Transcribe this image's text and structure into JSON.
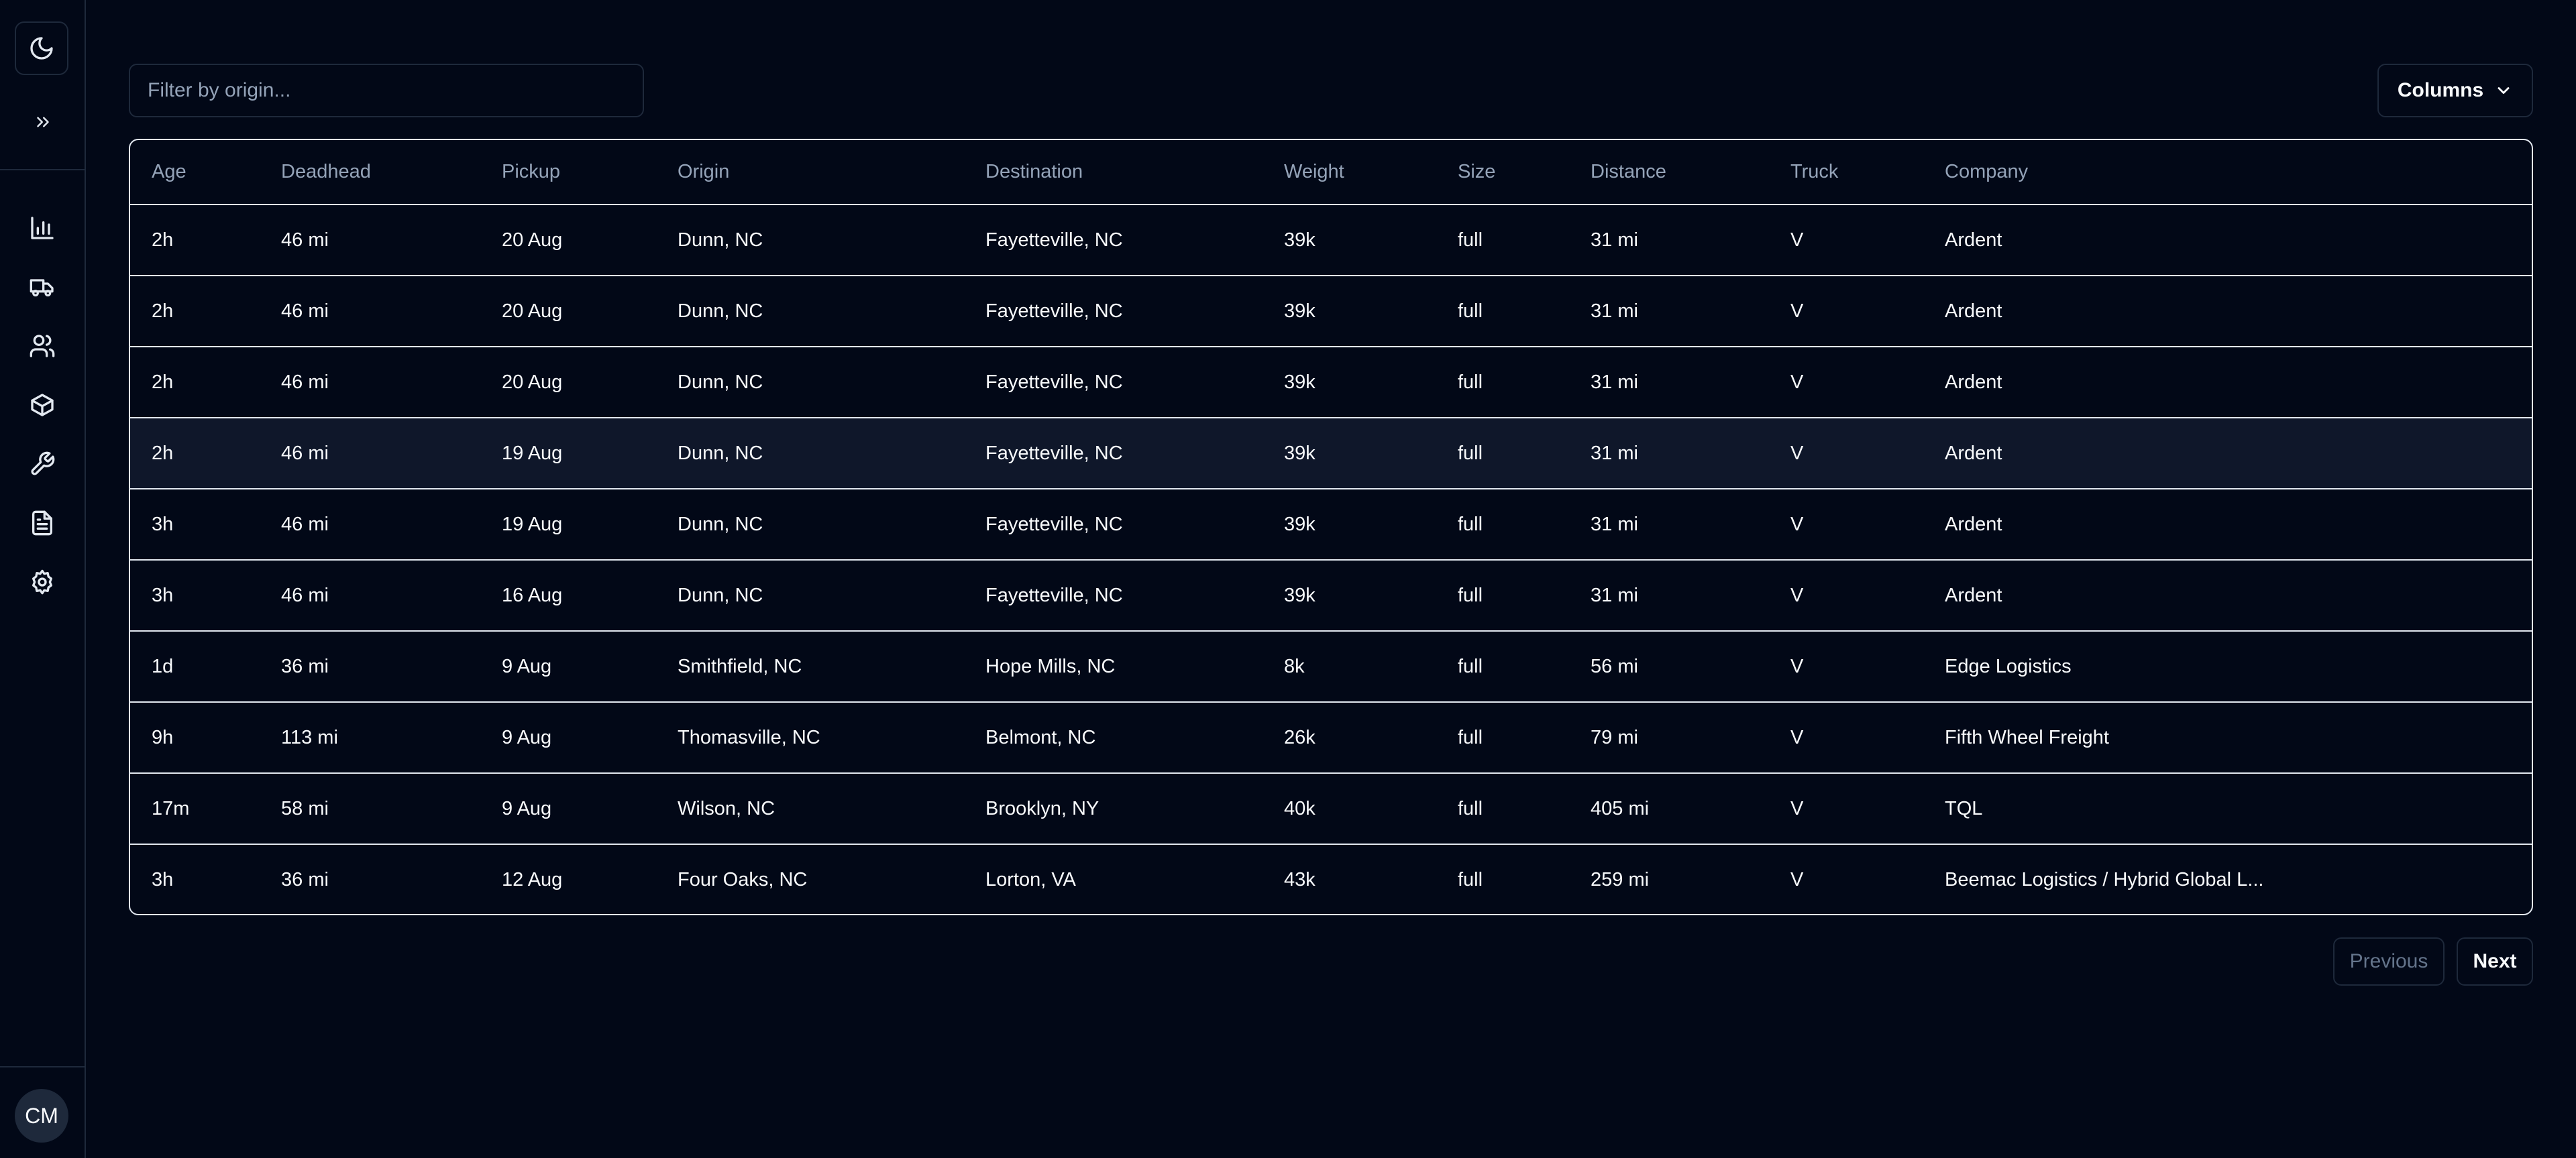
{
  "sidebar": {
    "avatar_initials": "CM",
    "nav": [
      {
        "icon": "bar-chart-icon"
      },
      {
        "icon": "truck-icon"
      },
      {
        "icon": "users-icon"
      },
      {
        "icon": "package-icon"
      },
      {
        "icon": "wrench-icon"
      },
      {
        "icon": "file-text-icon"
      },
      {
        "icon": "settings-icon"
      }
    ]
  },
  "toolbar": {
    "filter_placeholder": "Filter by origin...",
    "filter_value": "",
    "columns_label": "Columns"
  },
  "table": {
    "headers": [
      "Age",
      "Deadhead",
      "Pickup",
      "Origin",
      "Destination",
      "Weight",
      "Size",
      "Distance",
      "Truck",
      "Company"
    ],
    "rows": [
      [
        "2h",
        "46 mi",
        "20 Aug",
        "Dunn, NC",
        "Fayetteville, NC",
        "39k",
        "full",
        "31 mi",
        "V",
        "Ardent"
      ],
      [
        "2h",
        "46 mi",
        "20 Aug",
        "Dunn, NC",
        "Fayetteville, NC",
        "39k",
        "full",
        "31 mi",
        "V",
        "Ardent"
      ],
      [
        "2h",
        "46 mi",
        "20 Aug",
        "Dunn, NC",
        "Fayetteville, NC",
        "39k",
        "full",
        "31 mi",
        "V",
        "Ardent"
      ],
      [
        "2h",
        "46 mi",
        "19 Aug",
        "Dunn, NC",
        "Fayetteville, NC",
        "39k",
        "full",
        "31 mi",
        "V",
        "Ardent"
      ],
      [
        "3h",
        "46 mi",
        "19 Aug",
        "Dunn, NC",
        "Fayetteville, NC",
        "39k",
        "full",
        "31 mi",
        "V",
        "Ardent"
      ],
      [
        "3h",
        "46 mi",
        "16 Aug",
        "Dunn, NC",
        "Fayetteville, NC",
        "39k",
        "full",
        "31 mi",
        "V",
        "Ardent"
      ],
      [
        "1d",
        "36 mi",
        "9 Aug",
        "Smithfield, NC",
        "Hope Mills, NC",
        "8k",
        "full",
        "56 mi",
        "V",
        "Edge Logistics"
      ],
      [
        "9h",
        "113 mi",
        "9 Aug",
        "Thomasville, NC",
        "Belmont, NC",
        "26k",
        "full",
        "79 mi",
        "V",
        "Fifth Wheel Freight"
      ],
      [
        "17m",
        "58 mi",
        "9 Aug",
        "Wilson, NC",
        "Brooklyn, NY",
        "40k",
        "full",
        "405 mi",
        "V",
        "TQL"
      ],
      [
        "3h",
        "36 mi",
        "12 Aug",
        "Four Oaks, NC",
        "Lorton, VA",
        "43k",
        "full",
        "259 mi",
        "V",
        "Beemac Logistics / Hybrid Global L..."
      ]
    ]
  },
  "pagination": {
    "previous_label": "Previous",
    "next_label": "Next"
  }
}
